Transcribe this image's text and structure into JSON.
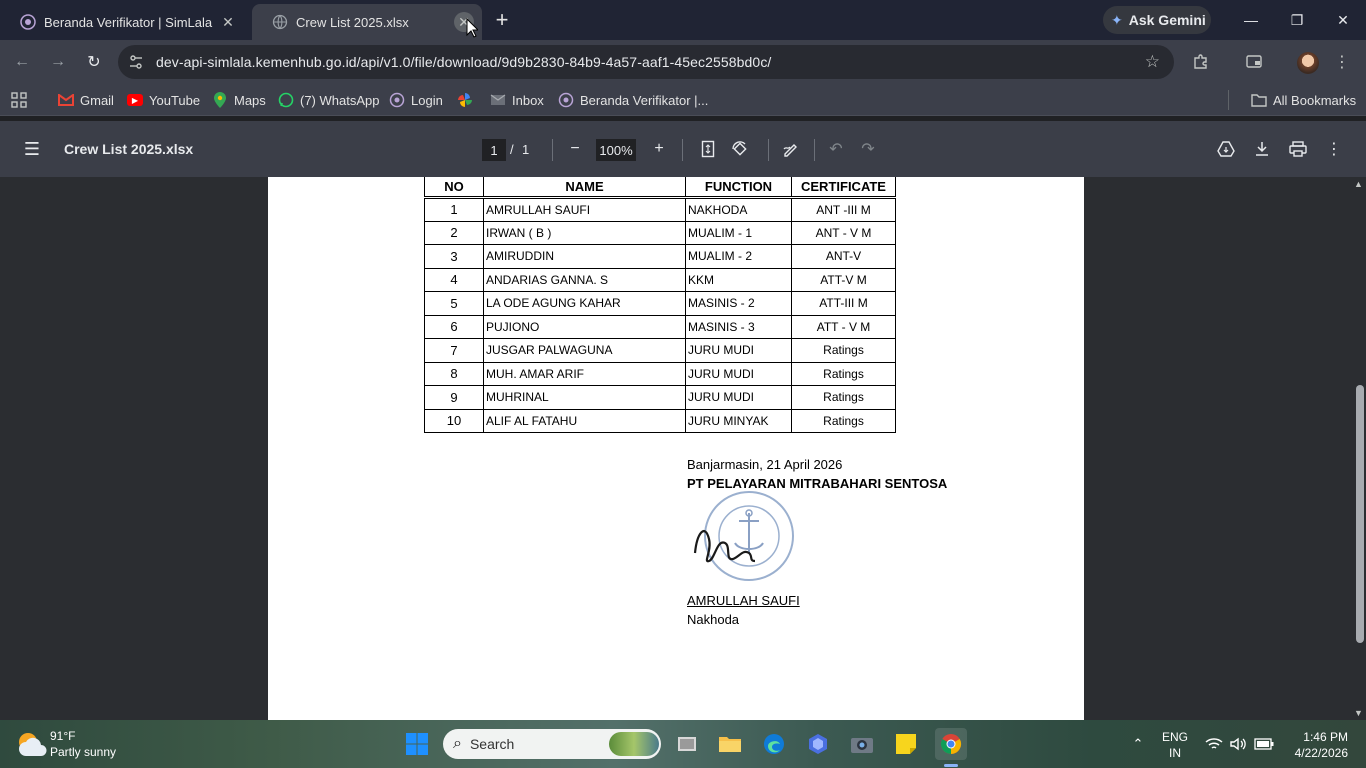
{
  "tabs": [
    {
      "title": "Beranda Verifikator | SimLala",
      "active": false
    },
    {
      "title": "Crew List 2025.xlsx",
      "active": true
    }
  ],
  "gemini_label": "Ask Gemini",
  "address_url": "dev-api-simlala.kemenhub.go.id/api/v1.0/file/download/9d9b2830-84b9-4a57-aaf1-45ec2558bd0c/",
  "bookmarks": [
    {
      "label": "Gmail",
      "icon": "gmail-icon"
    },
    {
      "label": "YouTube",
      "icon": "youtube-icon"
    },
    {
      "label": "Maps",
      "icon": "maps-icon"
    },
    {
      "label": "(7) WhatsApp",
      "icon": "whatsapp-icon"
    },
    {
      "label": "Login",
      "icon": "login-icon"
    },
    {
      "label": "",
      "icon": "pinwheel-icon"
    },
    {
      "label": "Inbox",
      "icon": "mail-icon"
    },
    {
      "label": "Beranda Verifikator |...",
      "icon": "simlala-icon"
    }
  ],
  "all_bookmarks_label": "All Bookmarks",
  "pdf": {
    "title": "Crew List 2025.xlsx",
    "page_current": "1",
    "page_separator": "/",
    "page_total": "1",
    "zoom": "100%"
  },
  "document": {
    "headers": {
      "no": "NO",
      "name": "NAME",
      "function": "FUNCTION",
      "certificate": "CERTIFICATE"
    },
    "rows": [
      {
        "no": "1",
        "name": "AMRULLAH SAUFI",
        "function": "NAKHODA",
        "certificate": "ANT -III M"
      },
      {
        "no": "2",
        "name": "IRWAN  ( B )",
        "function": "MUALIM - 1",
        "certificate": "ANT - V M"
      },
      {
        "no": "3",
        "name": "AMIRUDDIN",
        "function": "MUALIM - 2",
        "certificate": "ANT-V"
      },
      {
        "no": "4",
        "name": "ANDARIAS GANNA. S",
        "function": "KKM",
        "certificate": "ATT-V M"
      },
      {
        "no": "5",
        "name": "LA ODE AGUNG KAHAR",
        "function": "MASINIS - 2",
        "certificate": "ATT-III M"
      },
      {
        "no": "6",
        "name": "PUJIONO",
        "function": "MASINIS - 3",
        "certificate": "ATT - V M"
      },
      {
        "no": "7",
        "name": "JUSGAR PALWAGUNA",
        "function": "JURU MUDI",
        "certificate": "Ratings"
      },
      {
        "no": "8",
        "name": "MUH. AMAR ARIF",
        "function": "JURU MUDI",
        "certificate": "Ratings"
      },
      {
        "no": "9",
        "name": "MUHRINAL",
        "function": "JURU MUDI",
        "certificate": "Ratings"
      },
      {
        "no": "10",
        "name": "ALIF AL FATAHU",
        "function": "JURU MINYAK",
        "certificate": "Ratings"
      }
    ],
    "place_date": "Banjarmasin, 21 April 2026",
    "company": "PT PELAYARAN MITRABAHARI SENTOSA",
    "stamp_text": "MITRABAHARI SENTOSA INDONESIA",
    "signatory_name": "AMRULLAH SAUFI",
    "signatory_title": "Nakhoda"
  },
  "taskbar": {
    "weather_temp": "91°F",
    "weather_desc": "Partly sunny",
    "search_placeholder": "Search",
    "lang_line1": "ENG",
    "lang_line2": "IN",
    "time": "1:46 PM",
    "date": "4/22/2026"
  },
  "colors": {
    "tabstrip": "#202434",
    "toolbar": "#3c3f4a",
    "pdf_toolbar": "#3b3e48",
    "doc_background": "#2b2d31",
    "accent": "#8ab4f8"
  }
}
